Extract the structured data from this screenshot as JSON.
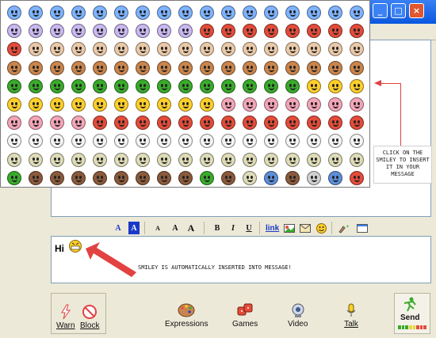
{
  "window": {
    "buttons": [
      "_",
      "□",
      "×"
    ]
  },
  "smiley_palette": {
    "rows": [
      [
        "#7fb3ff",
        "#7fb3ff",
        "#7fb3ff",
        "#7fb3ff",
        "#7fb3ff",
        "#7fb3ff",
        "#7fb3ff",
        "#7fb3ff",
        "#7fb3ff",
        "#7fb3ff",
        "#7fb3ff",
        "#7fb3ff",
        "#7fb3ff",
        "#7fb3ff",
        "#7fb3ff",
        "#7fb3ff",
        "#7fb3ff"
      ],
      [
        "#c9b8f0",
        "#c9b8f0",
        "#c9b8f0",
        "#c9b8f0",
        "#c9b8f0",
        "#c9b8f0",
        "#c9b8f0",
        "#c9b8f0",
        "#c9b8f0",
        "#e34c3a",
        "#e34c3a",
        "#e34c3a",
        "#e34c3a",
        "#e34c3a",
        "#e34c3a",
        "#e34c3a",
        "#e34c3a"
      ],
      [
        "#e34c3a",
        "#e9c9a8",
        "#e9c9a8",
        "#e9c9a8",
        "#e9c9a8",
        "#e9c9a8",
        "#e9c9a8",
        "#e9c9a8",
        "#e9c9a8",
        "#e9c9a8",
        "#e9c9a8",
        "#e9c9a8",
        "#e9c9a8",
        "#e9c9a8",
        "#e9c9a8",
        "#e9c9a8",
        "#e9c9a8"
      ],
      [
        "#c9854d",
        "#c9854d",
        "#c9854d",
        "#c9854d",
        "#c9854d",
        "#c9854d",
        "#c9854d",
        "#c9854d",
        "#c9854d",
        "#c9854d",
        "#c9854d",
        "#c9854d",
        "#c9854d",
        "#c9854d",
        "#c9854d",
        "#c9854d",
        "#c9854d"
      ],
      [
        "#3aaa2c",
        "#3aaa2c",
        "#3aaa2c",
        "#3aaa2c",
        "#3aaa2c",
        "#3aaa2c",
        "#3aaa2c",
        "#3aaa2c",
        "#3aaa2c",
        "#3aaa2c",
        "#3aaa2c",
        "#3aaa2c",
        "#3aaa2c",
        "#3aaa2c",
        "#ffcf2b",
        "#ffcf2b",
        "#ffcf2b"
      ],
      [
        "#ffcf2b",
        "#ffcf2b",
        "#ffcf2b",
        "#ffcf2b",
        "#ffcf2b",
        "#ffcf2b",
        "#ffcf2b",
        "#ffcf2b",
        "#ffcf2b",
        "#ffcf2b",
        "#f3a5b8",
        "#f3a5b8",
        "#f3a5b8",
        "#f3a5b8",
        "#f3a5b8",
        "#f3a5b8",
        "#f3a5b8"
      ],
      [
        "#f3a5b8",
        "#f3a5b8",
        "#f3a5b8",
        "#f3a5b8",
        "#e34c3a",
        "#e34c3a",
        "#e34c3a",
        "#e34c3a",
        "#e34c3a",
        "#e34c3a",
        "#e34c3a",
        "#e34c3a",
        "#e34c3a",
        "#e34c3a",
        "#e34c3a",
        "#e34c3a",
        "#e34c3a"
      ],
      [
        "#f4f4f4",
        "#f4f4f4",
        "#f4f4f4",
        "#f4f4f4",
        "#f4f4f4",
        "#f4f4f4",
        "#f4f4f4",
        "#f4f4f4",
        "#f4f4f4",
        "#f4f4f4",
        "#f4f4f4",
        "#f4f4f4",
        "#f4f4f4",
        "#f4f4f4",
        "#f4f4f4",
        "#f4f4f4",
        "#f4f4f4"
      ],
      [
        "#dedbb8",
        "#dedbb8",
        "#dedbb8",
        "#dedbb8",
        "#dedbb8",
        "#dedbb8",
        "#dedbb8",
        "#dedbb8",
        "#dedbb8",
        "#dedbb8",
        "#dedbb8",
        "#dedbb8",
        "#dedbb8",
        "#dedbb8",
        "#dedbb8",
        "#dedbb8",
        "#dedbb8"
      ],
      [
        "#3aaa2c",
        "#8a5a3c",
        "#8a5a3c",
        "#8a5a3c",
        "#8a5a3c",
        "#8a5a3c",
        "#8a5a3c",
        "#8a5a3c",
        "#8a5a3c",
        "#3aaa2c",
        "#8a5a3c",
        "#dedbb8",
        "#5e8ed8",
        "#8a5a3c",
        "#cfcfcf",
        "#5e8ed8",
        "#e34c3a"
      ]
    ]
  },
  "callout": {
    "text": "CLICK ON THE SMILEY TO INSERT IT IN YOUR MESSAGE"
  },
  "format_toolbar": {
    "items": [
      "A",
      "A",
      "A",
      "A",
      "A",
      "B",
      "I",
      "U",
      "link"
    ]
  },
  "compose": {
    "text": "Hi"
  },
  "annotation": {
    "text": "SMILEY IS AUTOMATICALLY INSERTED INTO MESSAGE!"
  },
  "bottom_toolbar": {
    "warn": "Warn",
    "block": "Block",
    "expressions": "Expressions",
    "games": "Games",
    "video": "Video",
    "talk": "Talk",
    "send": "Send"
  },
  "colors": {
    "arrow": "#e24242",
    "meter": [
      "#3aaa2c",
      "#3aaa2c",
      "#3aaa2c",
      "#e8d53a",
      "#e8d53a",
      "#e34c3a",
      "#e34c3a",
      "#e34c3a"
    ]
  }
}
